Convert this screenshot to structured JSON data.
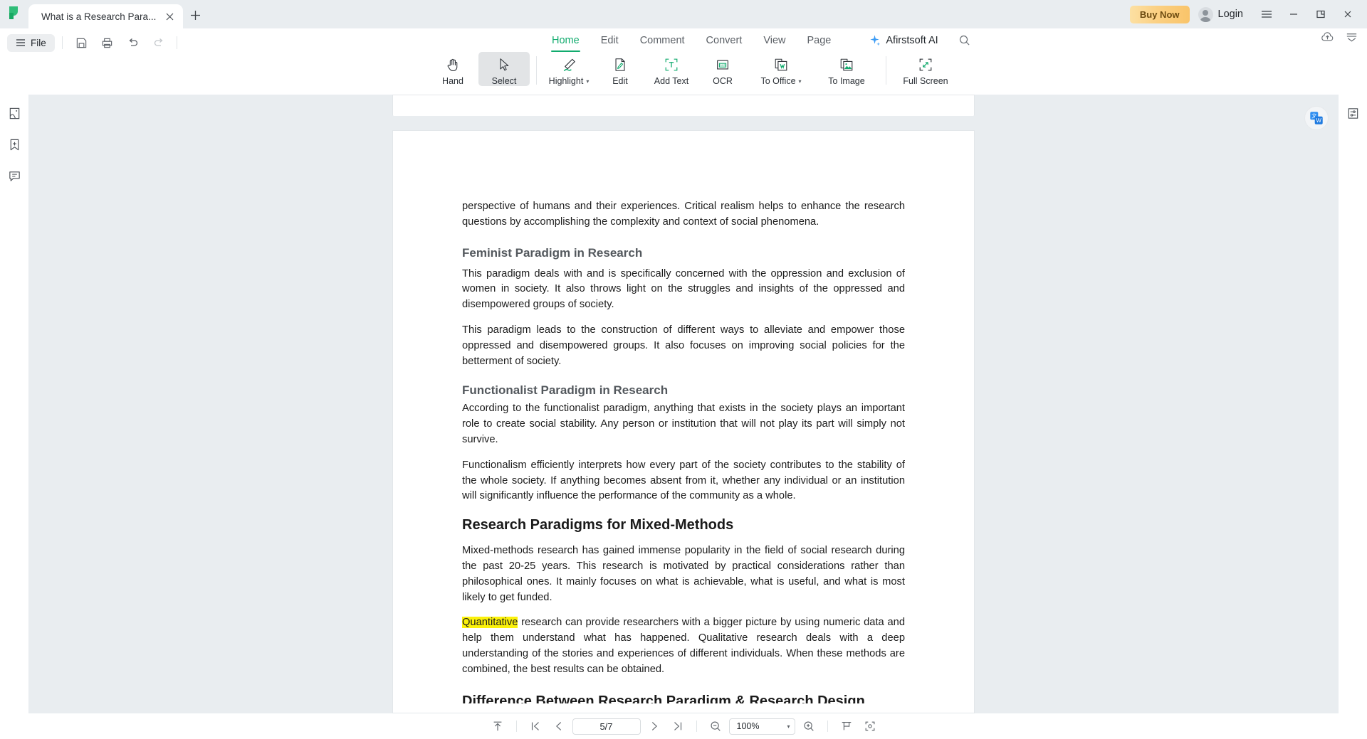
{
  "app": {
    "logo_icon": "afirstsoft-logo-icon",
    "tab_title": "What is a Research Para...",
    "tab_close_icon": "close-icon",
    "new_tab_icon": "plus-icon",
    "buy_now_label": "Buy Now",
    "login_label": "Login",
    "avatar_icon": "user-avatar-icon",
    "menu_icon": "hamburger-menu-icon",
    "minimize_icon": "minimize-icon",
    "restore_icon": "restore-window-icon",
    "close_icon": "close-window-icon"
  },
  "ribbon": {
    "file_label": "File",
    "file_menu_icon": "hamburger-icon",
    "quick_actions": [
      {
        "name": "save-icon",
        "title": "Save"
      },
      {
        "name": "print-icon",
        "title": "Print"
      },
      {
        "name": "undo-icon",
        "title": "Undo"
      },
      {
        "name": "redo-icon",
        "title": "Redo"
      }
    ],
    "tabs": [
      {
        "label": "Home",
        "active": true
      },
      {
        "label": "Edit",
        "active": false
      },
      {
        "label": "Comment",
        "active": false
      },
      {
        "label": "Convert",
        "active": false
      },
      {
        "label": "View",
        "active": false
      },
      {
        "label": "Page",
        "active": false
      }
    ],
    "ai_label": "Afirstsoft AI",
    "ai_icon": "sparkle-icon",
    "search_icon": "search-icon",
    "cloud_icon": "cloud-upload-icon",
    "collapse_icon": "collapse-ribbon-icon",
    "accent_color": "#11ab6e",
    "tools": [
      {
        "label": "Hand",
        "icon": "hand-icon",
        "active": false,
        "caret": false
      },
      {
        "label": "Select",
        "icon": "cursor-arrow-icon",
        "active": true,
        "caret": false
      },
      {
        "label": "Highlight",
        "icon": "highlight-pen-icon",
        "active": false,
        "caret": true
      },
      {
        "label": "Edit",
        "icon": "edit-document-icon",
        "active": false,
        "caret": false
      },
      {
        "label": "Add Text",
        "icon": "add-text-icon",
        "active": false,
        "caret": false
      },
      {
        "label": "OCR",
        "icon": "ocr-icon",
        "active": false,
        "caret": false
      },
      {
        "label": "To Office",
        "icon": "to-office-icon",
        "active": false,
        "caret": true
      },
      {
        "label": "To Image",
        "icon": "to-image-icon",
        "active": false,
        "caret": false
      },
      {
        "label": "Full Screen",
        "icon": "full-screen-icon",
        "active": false,
        "caret": false
      }
    ]
  },
  "left_sidebar": [
    {
      "icon": "page-thumbnails-icon"
    },
    {
      "icon": "add-bookmark-icon"
    },
    {
      "icon": "comments-icon"
    }
  ],
  "right_sidebar": [
    {
      "icon": "settings-sliders-icon"
    }
  ],
  "viewer": {
    "translate_fab_icon": "translate-icon"
  },
  "document": {
    "para_top": "perspective of humans and their experiences. Critical realism helps to enhance the research questions by accomplishing the complexity and context of social phenomena.",
    "h_feminist": "Feminist Paradigm in Research",
    "para_feminist_1": "This paradigm deals with and is specifically concerned with the oppression and exclusion of women in society. It also throws light on the struggles and insights of the oppressed and disempowered groups of society.",
    "para_feminist_2": "This paradigm leads to the construction of different ways to alleviate and empower those oppressed and disempowered groups. It also focuses on improving social policies for the betterment of society.",
    "h_functionalist": "Functionalist Paradigm in Research",
    "para_functionalist_1": "According to the functionalist paradigm, anything that exists in the society plays an important role to create social stability. Any person or institution that will not play its part will simply not survive.",
    "para_functionalist_2": "Functionalism efficiently interprets how every part of the society contributes to the stability of the whole society. If anything becomes absent from it, whether any individual or an institution will significantly influence the performance of the community as a whole.",
    "h_mixed": "Research Paradigms for Mixed-Methods",
    "para_mixed_1": "Mixed-methods research has gained immense popularity in the field of social research during the past 20-25 years. This research is motivated by practical considerations rather than philosophical ones. It mainly focuses on what is achievable, what is useful, and what is most likely to get funded.",
    "highlight_word": "Quantitative",
    "highlight_color": "#fbf10b",
    "para_quant_rest": " research can provide researchers with a bigger picture by using numeric data and help them understand what has happened. Qualitative research deals with a deep understanding of the stories and experiences of different individuals. When these methods are combined, the best results can be obtained.",
    "h_cutoff": "Difference Between Research Paradigm & Research Design"
  },
  "bottombar": {
    "scroll_top_icon": "scroll-to-top-icon",
    "first_page_icon": "first-page-icon",
    "prev_page_icon": "previous-page-icon",
    "page_value": "5/7",
    "next_page_icon": "next-page-icon",
    "last_page_icon": "last-page-icon",
    "zoom_out_icon": "zoom-out-icon",
    "zoom_value": "100%",
    "zoom_caret_icon": "chevron-down-icon",
    "zoom_in_icon": "zoom-in-icon",
    "fit_width_icon": "fit-width-icon",
    "fit_page_icon": "fit-page-icon"
  }
}
